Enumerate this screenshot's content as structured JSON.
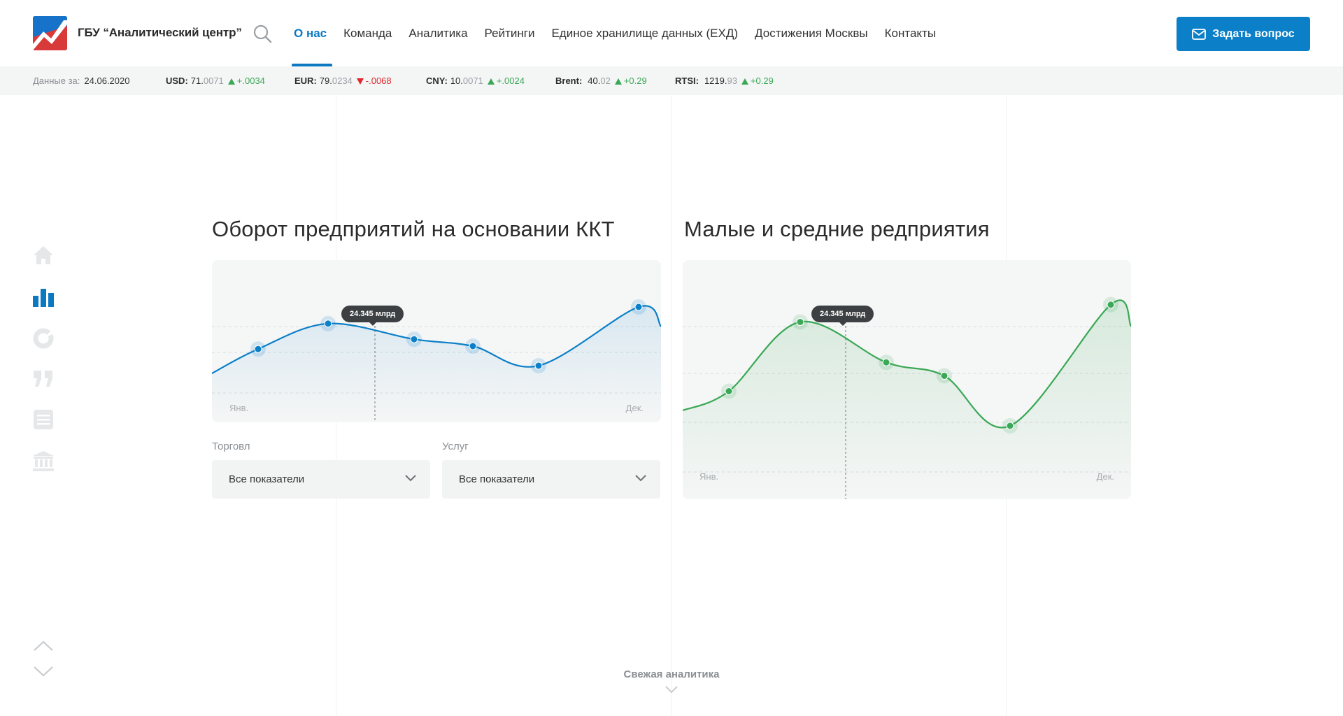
{
  "header": {
    "brand": "ГБУ “Аналитический центр”",
    "ask_button": "Задать вопрос",
    "nav": [
      {
        "label": "О нас",
        "active": true
      },
      {
        "label": "Команда"
      },
      {
        "label": "Аналитика"
      },
      {
        "label": "Рейтинги"
      },
      {
        "label": "Единое хранилище данных (ЕХД)"
      },
      {
        "label": "Достижения Москвы"
      },
      {
        "label": "Контакты"
      }
    ]
  },
  "ticker": {
    "date_label": "Данные за:",
    "date": "24.06.2020",
    "items": [
      {
        "code": "USD:",
        "value_main": "71.",
        "value_faint": "0071",
        "change": "+.0034",
        "direction": "up"
      },
      {
        "code": "EUR:",
        "value_main": "79.",
        "value_faint": "0234",
        "change": "-.0068",
        "direction": "down"
      },
      {
        "code": "CNY:",
        "value_main": "10.",
        "value_faint": "0071",
        "change": "+.0024",
        "direction": "up"
      },
      {
        "code": "Brent:",
        "value_main": "40.",
        "value_faint": "02",
        "change": "+0.29",
        "direction": "up"
      },
      {
        "code": "RTSI:",
        "value_main": "1219.",
        "value_faint": "93",
        "change": "+0.29",
        "direction": "up"
      }
    ]
  },
  "sidebar": {
    "icons": [
      "home-icon",
      "bar-chart-icon",
      "donut-icon",
      "quote-icon",
      "document-icon",
      "bank-icon"
    ],
    "active": "bar-chart-icon"
  },
  "section_left": {
    "title": "Оборот предприятий на основании ККТ",
    "tooltip": "24.345 млрд",
    "month_start": "Янв.",
    "month_end": "Дек.",
    "filter1_label": "Торговл",
    "filter1_value": "Все показатели",
    "filter2_label": "Услуг",
    "filter2_value": "Все показатели"
  },
  "section_right": {
    "title": "Малые и средние редприятия",
    "tooltip": "24.345 млрд",
    "month_start": "Янв.",
    "month_end": "Дек."
  },
  "footer": {
    "fresh_label": "Свежая аналитика"
  },
  "colors": {
    "accent": "#0b78c2",
    "button": "#0b7fc8",
    "green": "#3aa856",
    "red": "#e0262e"
  },
  "chart_data": [
    {
      "type": "line",
      "color": "#0b7fc8",
      "points": [
        0.52,
        0.78,
        0.62,
        0.55,
        0.35,
        0.95
      ],
      "highlight_tooltip": "24.345 млрд"
    },
    {
      "type": "area",
      "color": "#3aa856",
      "points": [
        0.5,
        0.86,
        0.65,
        0.58,
        0.32,
        0.95
      ],
      "highlight_tooltip": "24.345 млрд"
    }
  ]
}
